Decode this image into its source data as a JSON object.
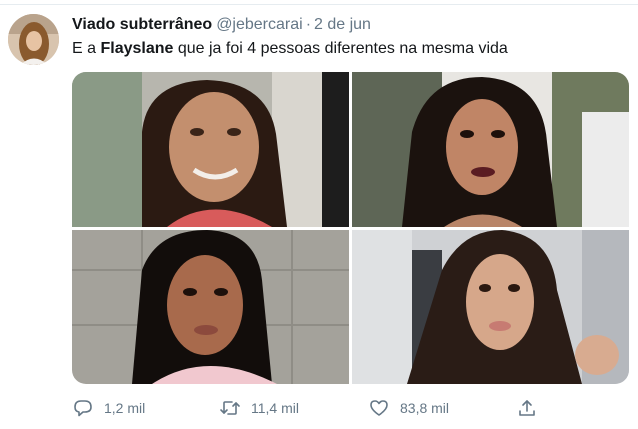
{
  "tweet": {
    "display_name": "Viado subterrâneo",
    "handle": "@jebercarai",
    "separator": "·",
    "date": "2 de jun",
    "text_before": "E a ",
    "text_bold": "Flayslane",
    "text_after": " que ja foi 4 pessoas diferentes na mesma vida",
    "avatar_icon": "profile-photo",
    "media": [
      {
        "icon": "photo-woman-1"
      },
      {
        "icon": "photo-woman-2"
      },
      {
        "icon": "photo-woman-3"
      },
      {
        "icon": "photo-woman-4"
      }
    ],
    "actions": {
      "reply_count": "1,2 mil",
      "retweet_count": "11,4 mil",
      "like_count": "83,8 mil",
      "reply_icon": "speech-bubble-icon",
      "retweet_icon": "retweet-arrows-icon",
      "like_icon": "heart-icon",
      "share_icon": "share-upload-icon"
    }
  },
  "colors": {
    "text": "#14171a",
    "muted": "#657786",
    "border": "#e6ecf0"
  }
}
